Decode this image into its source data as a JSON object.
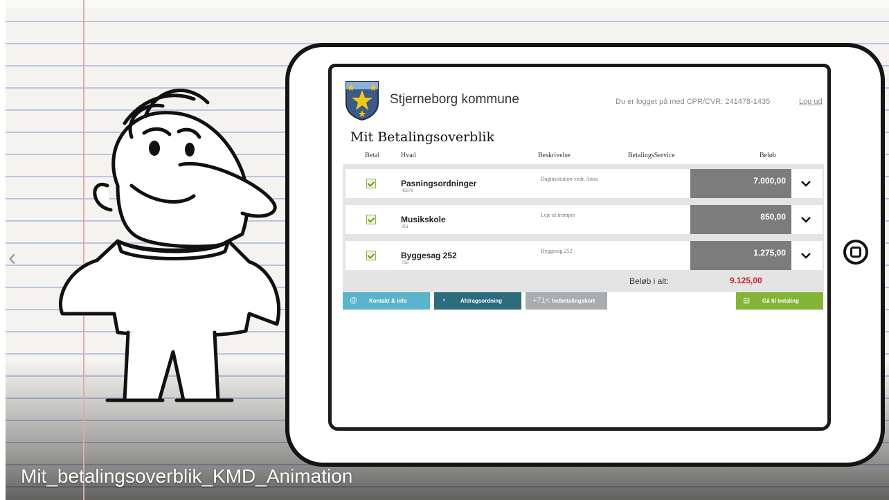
{
  "video": {
    "title": "Mit_betalingsoverblik_KMD_Animation"
  },
  "nav": {
    "prev_symbol": "‹"
  },
  "app": {
    "municipality": "Stjerneborg kommune",
    "login_info": "Du er logget på med CPR/CVR: 241478-1435",
    "logout_label": "Log ud",
    "page_title": "Mit Betalingsoverblik"
  },
  "table": {
    "headers": {
      "pay": "Betal",
      "what": "Hvad",
      "description": "Beskrivelse",
      "service": "BetalingsService",
      "amount": "Beløb"
    },
    "rows": [
      {
        "name": "Pasningsordninger",
        "number": "45678",
        "description": "Daginstitution vedr. Anna",
        "amount": "7.000,00",
        "checked": true
      },
      {
        "name": "Musikskole",
        "number": "951",
        "description": "Leje af trompet",
        "amount": "850,00",
        "checked": true
      },
      {
        "name": "Byggesag 252",
        "number": "758",
        "description": "Byggesag 252",
        "amount": "1.275,00",
        "checked": true
      }
    ],
    "total_label": "Beløb i alt:",
    "total_value": "9.125,00"
  },
  "buttons": {
    "contact": {
      "icon": "at-icon",
      "glyph": "@",
      "label": "Kontakt & info"
    },
    "installment": {
      "icon": "pie-chart-icon",
      "glyph": "◔",
      "label": "Afdragsordning"
    },
    "paycard": {
      "icon": "paycard-icon",
      "glyph": "+71<",
      "label": "Indbetalingskort"
    },
    "pay": {
      "icon": "payment-icon",
      "glyph": "▤",
      "label": "Gå til betaling"
    }
  },
  "colors": {
    "contact": "#5bb4c9",
    "installment": "#2c6c7d",
    "paycard": "#a9adaf",
    "pay": "#84b436",
    "total": "#c0242b",
    "amount_box": "#7c7c7c"
  }
}
